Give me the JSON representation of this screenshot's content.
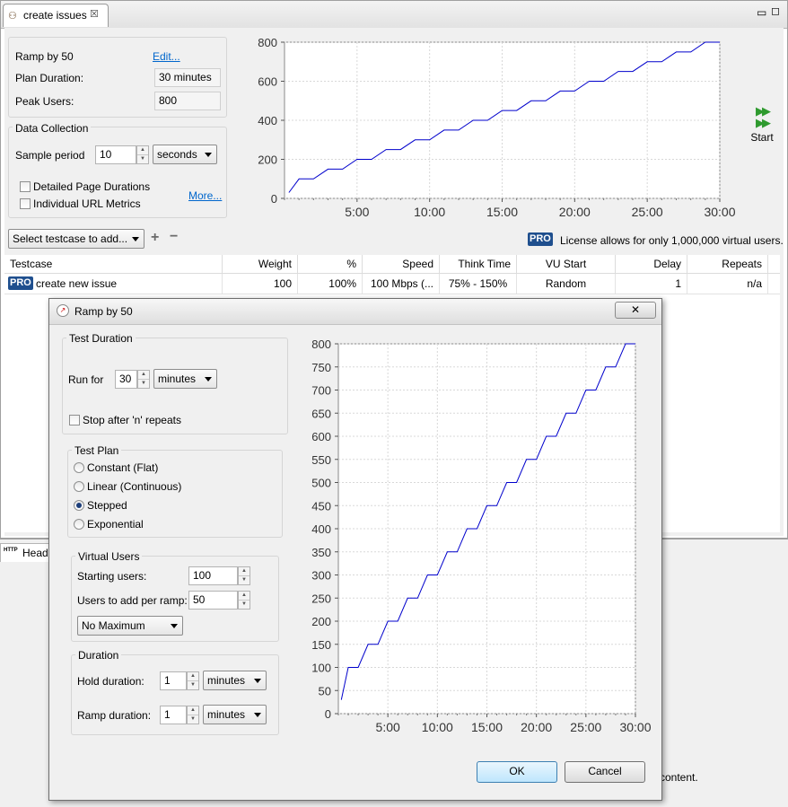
{
  "editor": {
    "tab_title": "create issues",
    "plan_name": "Ramp by 50",
    "edit_link": "Edit...",
    "plan_duration_label": "Plan Duration:",
    "plan_duration_value": "30 minutes",
    "peak_users_label": "Peak Users:",
    "peak_users_value": "800",
    "data_collection_title": "Data Collection",
    "sample_period_label": "Sample period",
    "sample_period_value": "10",
    "sample_unit": "seconds",
    "detailed_page_durations": "Detailed Page Durations",
    "individual_url_metrics": "Individual URL Metrics",
    "more_link": "More...",
    "start_label": "Start",
    "select_testcase": "Select testcase to add...",
    "pro_badge": "PRO",
    "license_text": "License allows for only 1,000,000 virtual users."
  },
  "table": {
    "columns": [
      "Testcase",
      "Weight",
      "%",
      "Speed",
      "Think Time",
      "VU Start",
      "Delay",
      "Repeats"
    ],
    "rows": [
      {
        "testcase": "create new issue",
        "weight": "100",
        "percent": "100%",
        "speed": "100 Mbps (...",
        "think_time": "75% - 150%",
        "vu_start": "Random",
        "delay": "1",
        "repeats": "n/a"
      }
    ]
  },
  "lower_view": {
    "tab_label": "Heade",
    "partial_text": "content."
  },
  "dialog": {
    "title": "Ramp by 50",
    "test_duration_title": "Test Duration",
    "run_for_label": "Run for",
    "run_for_value": "30",
    "run_for_unit": "minutes",
    "stop_after_repeats": "Stop after 'n' repeats",
    "test_plan_title": "Test Plan",
    "plan_options": [
      "Constant (Flat)",
      "Linear (Continuous)",
      "Stepped",
      "Exponential"
    ],
    "plan_selected": "Stepped",
    "virtual_users_title": "Virtual Users",
    "starting_users_label": "Starting users:",
    "starting_users_value": "100",
    "users_per_ramp_label": "Users to add per ramp:",
    "users_per_ramp_value": "50",
    "maximum_option": "No Maximum",
    "duration_title": "Duration",
    "hold_duration_label": "Hold duration:",
    "hold_duration_value": "1",
    "hold_duration_unit": "minutes",
    "ramp_duration_label": "Ramp duration:",
    "ramp_duration_value": "1",
    "ramp_duration_unit": "minutes",
    "ok_label": "OK",
    "cancel_label": "Cancel"
  },
  "chart_data": [
    {
      "type": "line",
      "x_ticks": [
        "5:00",
        "10:00",
        "15:00",
        "20:00",
        "25:00",
        "30:00"
      ],
      "y_ticks": [
        0,
        200,
        400,
        600,
        800
      ],
      "xlim": [
        0,
        30
      ],
      "ylim": [
        0,
        800
      ],
      "grid": true,
      "series": [
        {
          "color": "#0000cc",
          "x": [
            0.3,
            1,
            2,
            3,
            4,
            5,
            6,
            7,
            8,
            9,
            10,
            11,
            12,
            13,
            14,
            15,
            16,
            17,
            18,
            19,
            20,
            21,
            22,
            23,
            24,
            25,
            26,
            27,
            28,
            29,
            30
          ],
          "y": [
            30,
            100,
            100,
            150,
            150,
            200,
            200,
            250,
            250,
            300,
            300,
            350,
            350,
            400,
            400,
            450,
            450,
            500,
            500,
            550,
            550,
            600,
            600,
            650,
            650,
            700,
            700,
            750,
            750,
            800,
            800
          ]
        }
      ]
    },
    {
      "type": "line",
      "x_ticks": [
        "5:00",
        "10:00",
        "15:00",
        "20:00",
        "25:00",
        "30:00"
      ],
      "y_ticks": [
        0,
        50,
        100,
        150,
        200,
        250,
        300,
        350,
        400,
        450,
        500,
        550,
        600,
        650,
        700,
        750,
        800
      ],
      "xlim": [
        0,
        30
      ],
      "ylim": [
        0,
        800
      ],
      "grid": true,
      "series": [
        {
          "color": "#0000cc",
          "x": [
            0.3,
            1,
            2,
            3,
            4,
            5,
            6,
            7,
            8,
            9,
            10,
            11,
            12,
            13,
            14,
            15,
            16,
            17,
            18,
            19,
            20,
            21,
            22,
            23,
            24,
            25,
            26,
            27,
            28,
            29,
            30
          ],
          "y": [
            30,
            100,
            100,
            150,
            150,
            200,
            200,
            250,
            250,
            300,
            300,
            350,
            350,
            400,
            400,
            450,
            450,
            500,
            500,
            550,
            550,
            600,
            600,
            650,
            650,
            700,
            700,
            750,
            750,
            800,
            800
          ]
        }
      ]
    }
  ]
}
